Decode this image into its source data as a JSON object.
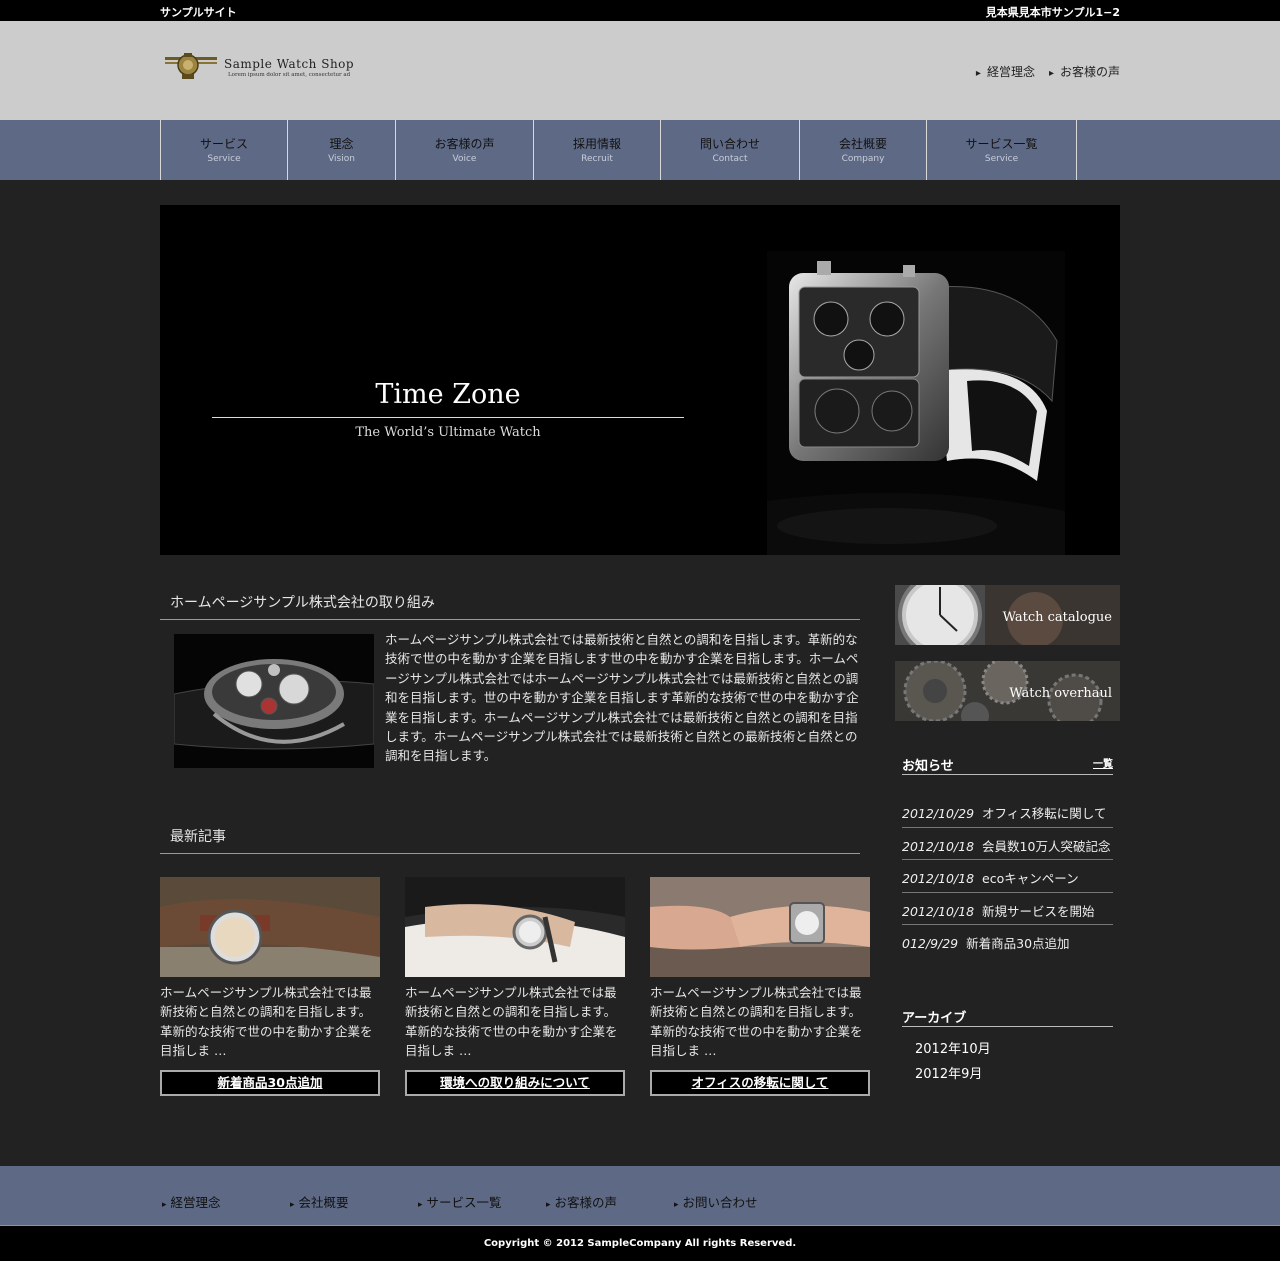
{
  "topbar": {
    "site_name": "サンプルサイト",
    "address": "見本県見本市サンプル1−2"
  },
  "header": {
    "logo_name": "Sample Watch Shop",
    "logo_tagline": "Lorem ipsum dolor sit amet, consectetur ad",
    "links": [
      "経営理念",
      "お客様の声"
    ]
  },
  "nav": [
    {
      "jp": "サービス",
      "en": "Service"
    },
    {
      "jp": "理念",
      "en": "Vision"
    },
    {
      "jp": "お客様の声",
      "en": "Voice"
    },
    {
      "jp": "採用情報",
      "en": "Recruit"
    },
    {
      "jp": "問い合わせ",
      "en": "Contact"
    },
    {
      "jp": "会社概要",
      "en": "Company"
    },
    {
      "jp": "サービス一覧",
      "en": "Service"
    }
  ],
  "hero": {
    "title": "Time Zone",
    "subtitle": "The World’s Ultimate Watch"
  },
  "intro": {
    "heading": "ホームページサンプル株式会社の取り組み",
    "text": "ホームページサンプル株式会社では最新技術と自然との調和を目指します。革新的な技術で世の中を動かす企業を目指します世の中を動かす企業を目指します。ホームページサンプル株式会社ではホームページサンプル株式会社では最新技術と自然との調和を目指します。世の中を動かす企業を目指します革新的な技術で世の中を動かす企業を目指します。ホームページサンプル株式会社では最新技術と自然との調和を目指します。ホームページサンプル株式会社では最新技術と自然との最新技術と自然との調和を目指します。"
  },
  "latest": {
    "heading": "最新記事",
    "articles": [
      {
        "excerpt": "ホームページサンプル株式会社では最新技術と自然との調和を目指します。革新的な技術で世の中を動かす企業を目指しま …",
        "button": "新着商品30点追加"
      },
      {
        "excerpt": "ホームページサンプル株式会社では最新技術と自然との調和を目指します。革新的な技術で世の中を動かす企業を目指しま …",
        "button": "環境への取り組みについて"
      },
      {
        "excerpt": "ホームページサンプル株式会社では最新技術と自然との調和を目指します。革新的な技術で世の中を動かす企業を目指しま …",
        "button": "オフィスの移転に関して"
      }
    ]
  },
  "sidebar": {
    "banners": [
      "Watch catalogue",
      "Watch overhaul"
    ],
    "news_heading": "お知らせ",
    "news_more": "一覧",
    "news": [
      {
        "date": "2012/10/29",
        "title": "オフィス移転に関して"
      },
      {
        "date": "2012/10/18",
        "title": "会員数10万人突破記念"
      },
      {
        "date": "2012/10/18",
        "title": "ecoキャンペーン"
      },
      {
        "date": "2012/10/18",
        "title": "新規サービスを開始"
      },
      {
        "date": "012/9/29",
        "title": "新着商品30点追加"
      }
    ],
    "archive_heading": "アーカイブ",
    "archive": [
      "2012年10月",
      "2012年9月"
    ]
  },
  "footer": {
    "links": [
      "経営理念",
      "会社概要",
      "サービス一覧",
      "お客様の声",
      "お問い合わせ"
    ],
    "copyright": "Copyright © 2012 SampleCompany All rights Reserved."
  }
}
